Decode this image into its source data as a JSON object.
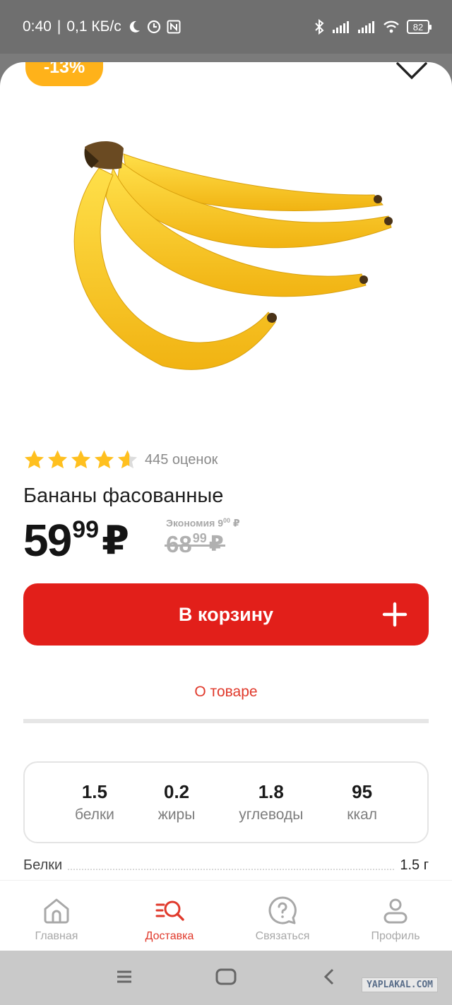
{
  "status_bar": {
    "time": "0:40",
    "network_speed": "0,1 КБ/с",
    "battery": "82"
  },
  "product": {
    "discount_badge": "-13%",
    "image_icon": "banana-bunch",
    "rating": 4.5,
    "rating_max": 5,
    "rating_count": "445 оценок",
    "title": "Бананы фасованные",
    "price_int": "59",
    "price_frac": "99",
    "currency": "₽",
    "savings_label": "Экономия",
    "savings_int": "9",
    "savings_frac": "00",
    "old_price_int": "68",
    "old_price_frac": "99",
    "add_to_cart": "В корзину"
  },
  "tabs": {
    "about": "О товаре"
  },
  "nutrition": [
    {
      "value": "1.5",
      "label": "белки"
    },
    {
      "value": "0.2",
      "label": "жиры"
    },
    {
      "value": "1.8",
      "label": "углеводы"
    },
    {
      "value": "95",
      "label": "ккал"
    }
  ],
  "details": [
    {
      "label": "Белки",
      "value": "1.5 г"
    }
  ],
  "bottom_nav": [
    {
      "label": "Главная",
      "icon": "home-icon",
      "active": false
    },
    {
      "label": "Доставка",
      "icon": "delivery-search-icon",
      "active": true
    },
    {
      "label": "Связаться",
      "icon": "help-chat-icon",
      "active": false
    },
    {
      "label": "Профиль",
      "icon": "profile-icon",
      "active": false
    }
  ],
  "watermark": "YAPLAKAL.COM",
  "colors": {
    "accent_red": "#e21f1a",
    "badge_orange": "#ffb21a",
    "star_yellow": "#ffc01f"
  }
}
